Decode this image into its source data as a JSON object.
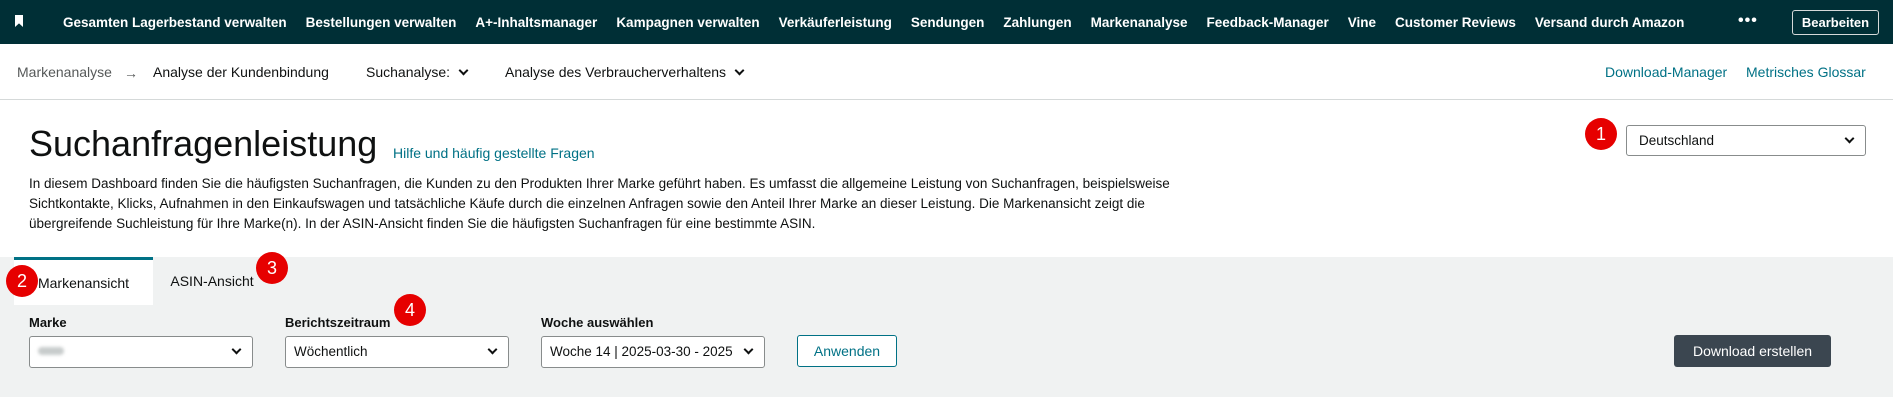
{
  "topnav": {
    "items": [
      "Gesamten Lagerbestand verwalten",
      "Bestellungen verwalten",
      "A+-Inhaltsmanager",
      "Kampagnen verwalten",
      "Verkäuferleistung",
      "Sendungen",
      "Zahlungen",
      "Markenanalyse",
      "Feedback-Manager",
      "Vine",
      "Customer Reviews",
      "Versand durch Amazon"
    ],
    "more_label": "•••",
    "edit_label": "Bearbeiten"
  },
  "subnav": {
    "breadcrumb": "Markenanalyse",
    "arrow": "→",
    "current": "Analyse der Kundenbindung",
    "search_analysis": "Suchanalyse:",
    "consumer_behavior": "Analyse des Verbraucherverhaltens",
    "download_manager": "Download-Manager",
    "metrics_glossary": "Metrisches Glossar"
  },
  "header": {
    "title": "Suchanfragenleistung",
    "help_link": "Hilfe und häufig gestellte Fragen",
    "description": "In diesem Dashboard finden Sie die häufigsten Suchanfragen, die Kunden zu den Produkten Ihrer Marke geführt haben. Es umfasst die allgemeine Leistung von Suchanfragen, beispielsweise Sichtkontakte, Klicks, Aufnahmen in den Einkaufswagen und tatsächliche Käufe durch die einzelnen Anfragen sowie den Anteil Ihrer Marke an dieser Leistung. Die Markenansicht zeigt die übergreifende Suchleistung für Ihre Marke(n). In der ASIN-Ansicht finden Sie die häufigsten Suchanfragen für eine bestimmte ASIN.",
    "country": "Deutschland"
  },
  "badges": [
    "1",
    "2",
    "3",
    "4"
  ],
  "tabs": [
    {
      "label": "Markenansicht"
    },
    {
      "label": "ASIN-Ansicht"
    }
  ],
  "filters": {
    "brand_label": "Marke",
    "period_label": "Berichtszeitraum",
    "period_value": "Wöchentlich",
    "week_label": "Woche auswählen",
    "week_value": "Woche 14 | 2025-03-30 - 2025",
    "apply": "Anwenden",
    "download": "Download erstellen"
  },
  "colors": {
    "topnav_bg": "#002f36",
    "link": "#007185",
    "badge": "#e60000",
    "panel_bg": "#f0f2f2",
    "download_btn": "#3b4650"
  }
}
